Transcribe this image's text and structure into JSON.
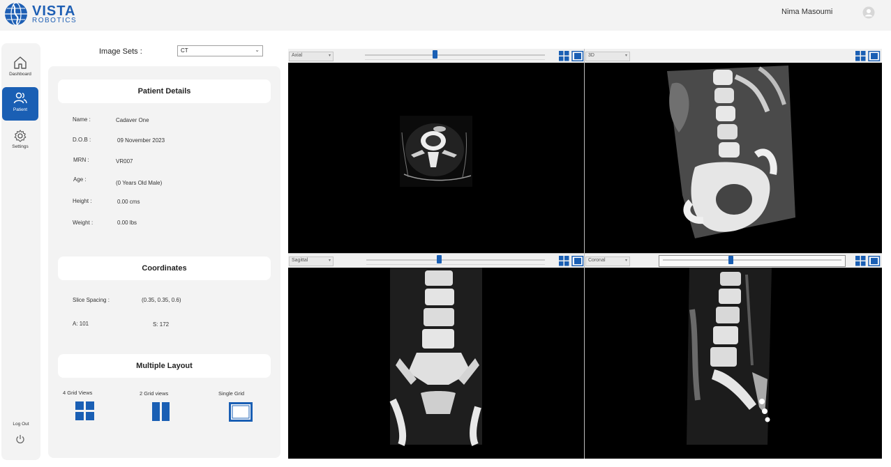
{
  "header": {
    "brand_line1": "VISTA",
    "brand_line2": "ROBOTICS",
    "user_name": "Nima Masoumi",
    "user_icon": "user-circle-icon"
  },
  "nav": {
    "items": [
      {
        "label": "Dashboard",
        "icon": "home-icon",
        "active": false
      },
      {
        "label": "Patient",
        "icon": "users-icon",
        "active": true
      },
      {
        "label": "Settings",
        "icon": "gear-icon",
        "active": false
      }
    ],
    "logout_label": "Log Out",
    "logout_icon": "power-icon"
  },
  "image_sets": {
    "label": "Image Sets :",
    "selected": "CT"
  },
  "patient_details": {
    "title": "Patient Details",
    "fields": [
      {
        "label": "Name :",
        "value": "Cadaver One"
      },
      {
        "label": "D.O.B :",
        "value": "09 November 2023"
      },
      {
        "label": "MRN :",
        "value": "VR007"
      },
      {
        "label": "Age :",
        "value": "(0 Years Old Male)"
      },
      {
        "label": "Height :",
        "value": "0.00 cms"
      },
      {
        "label": "Weight :",
        "value": "0.00 lbs"
      }
    ]
  },
  "coordinates": {
    "title": "Coordinates",
    "slice_spacing_label": "Slice Spacing :",
    "slice_spacing_value": "(0.35, 0.35, 0.6)",
    "a_value": "A: 101",
    "s_value": "S: 172"
  },
  "multiple_layout": {
    "title": "Multiple Layout",
    "options": [
      {
        "label": "4 Grid Views",
        "icon": "four-grid-icon"
      },
      {
        "label": "2 Grid views",
        "icon": "two-grid-icon"
      },
      {
        "label": "Single Grid",
        "icon": "single-grid-icon"
      }
    ]
  },
  "viewports": [
    {
      "view": "Axial",
      "slider_fraction": 0.39
    },
    {
      "view": "3D"
    },
    {
      "view": "Sagittal",
      "slider_fraction": 0.41
    },
    {
      "view": "Coronal",
      "slider_fraction": 0.38
    }
  ],
  "colors": {
    "accent": "#1a5fb4",
    "panel_bg": "#f3f3f3",
    "viewer_bg": "#000000"
  }
}
